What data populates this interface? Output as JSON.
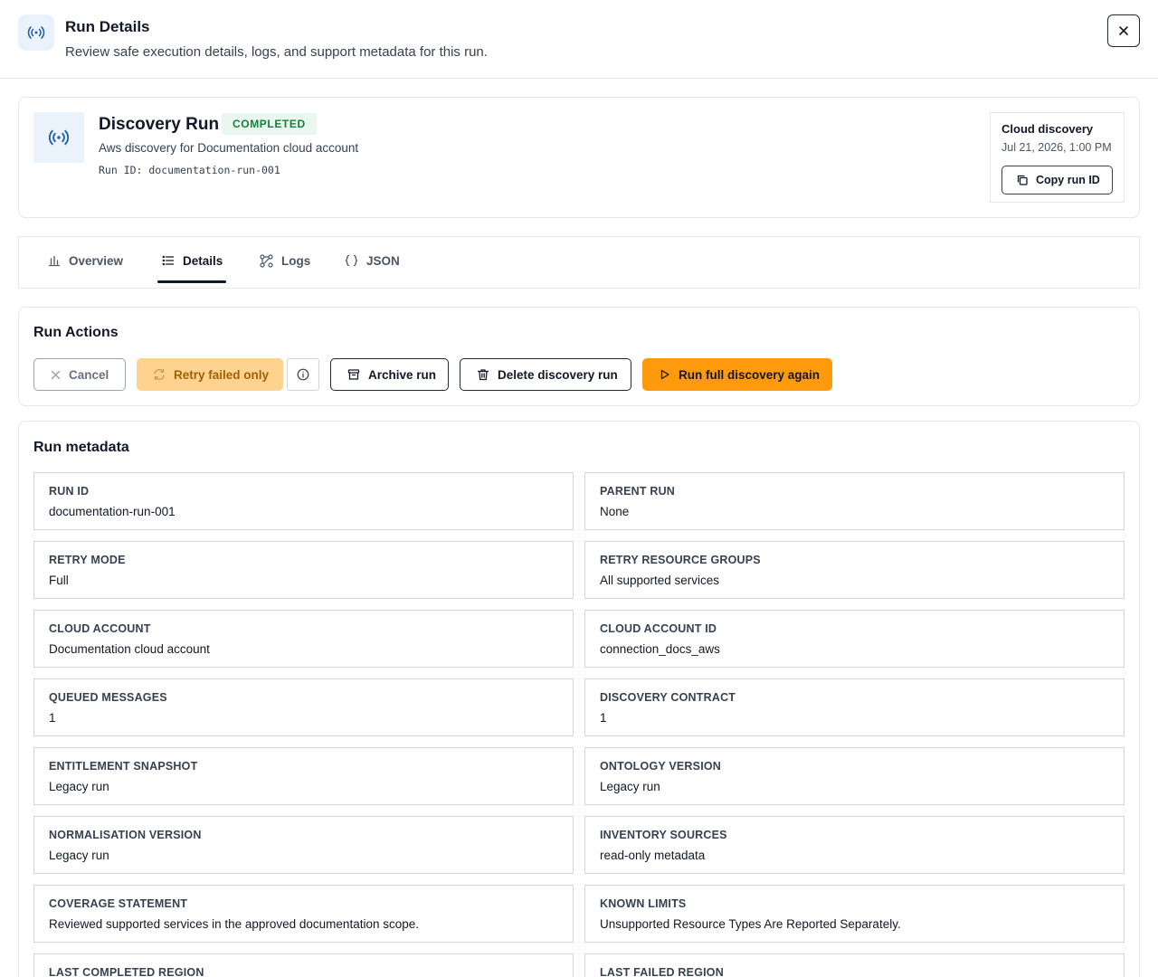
{
  "header": {
    "icon": "radar-icon",
    "title": "Run Details",
    "subtitle": "Review safe execution details, logs, and support metadata for this run."
  },
  "summary": {
    "icon": "radar-icon",
    "title": "Discovery Run",
    "status": "COMPLETED",
    "description": "Aws discovery for Documentation cloud account",
    "run_id_line": "Run ID: documentation-run-001",
    "side": {
      "type": "Cloud discovery",
      "date": "Jul 21, 2026, 1:00 PM",
      "copy_label": "Copy run ID"
    }
  },
  "tabs": [
    {
      "label": "Overview",
      "icon": "bar-chart-icon"
    },
    {
      "label": "Details",
      "icon": "list-icon",
      "active": true
    },
    {
      "label": "Logs",
      "icon": "branch-icon"
    },
    {
      "label": "JSON",
      "icon": "braces-icon"
    }
  ],
  "actions": {
    "title": "Run Actions",
    "cancel": "Cancel",
    "retry": "Retry failed only",
    "archive": "Archive run",
    "delete": "Delete discovery run",
    "run_again": "Run full discovery again"
  },
  "metadata": {
    "title": "Run metadata",
    "items": [
      {
        "label": "RUN ID",
        "value": "documentation-run-001"
      },
      {
        "label": "PARENT RUN",
        "value": "None"
      },
      {
        "label": "RETRY MODE",
        "value": "Full"
      },
      {
        "label": "RETRY RESOURCE GROUPS",
        "value": "All supported services"
      },
      {
        "label": "CLOUD ACCOUNT",
        "value": "Documentation cloud account"
      },
      {
        "label": "CLOUD ACCOUNT ID",
        "value": "connection_docs_aws"
      },
      {
        "label": "QUEUED MESSAGES",
        "value": "1"
      },
      {
        "label": "DISCOVERY CONTRACT",
        "value": "1"
      },
      {
        "label": "ENTITLEMENT SNAPSHOT",
        "value": "Legacy run"
      },
      {
        "label": "ONTOLOGY VERSION",
        "value": "Legacy run"
      },
      {
        "label": "NORMALISATION VERSION",
        "value": "Legacy run"
      },
      {
        "label": "INVENTORY SOURCES",
        "value": "read-only metadata"
      },
      {
        "label": "COVERAGE STATEMENT",
        "value": "Reviewed supported services in the approved documentation scope."
      },
      {
        "label": "KNOWN LIMITS",
        "value": "Unsupported Resource Types Are Reported Separately."
      },
      {
        "label": "LAST COMPLETED REGION",
        "value": ""
      },
      {
        "label": "LAST FAILED REGION",
        "value": ""
      }
    ]
  },
  "colors": {
    "accent_orange": "#fe9a0c",
    "status_green": "#15803d",
    "icon_bg": "#eaf3fb",
    "icon_blue": "#2563a8"
  }
}
